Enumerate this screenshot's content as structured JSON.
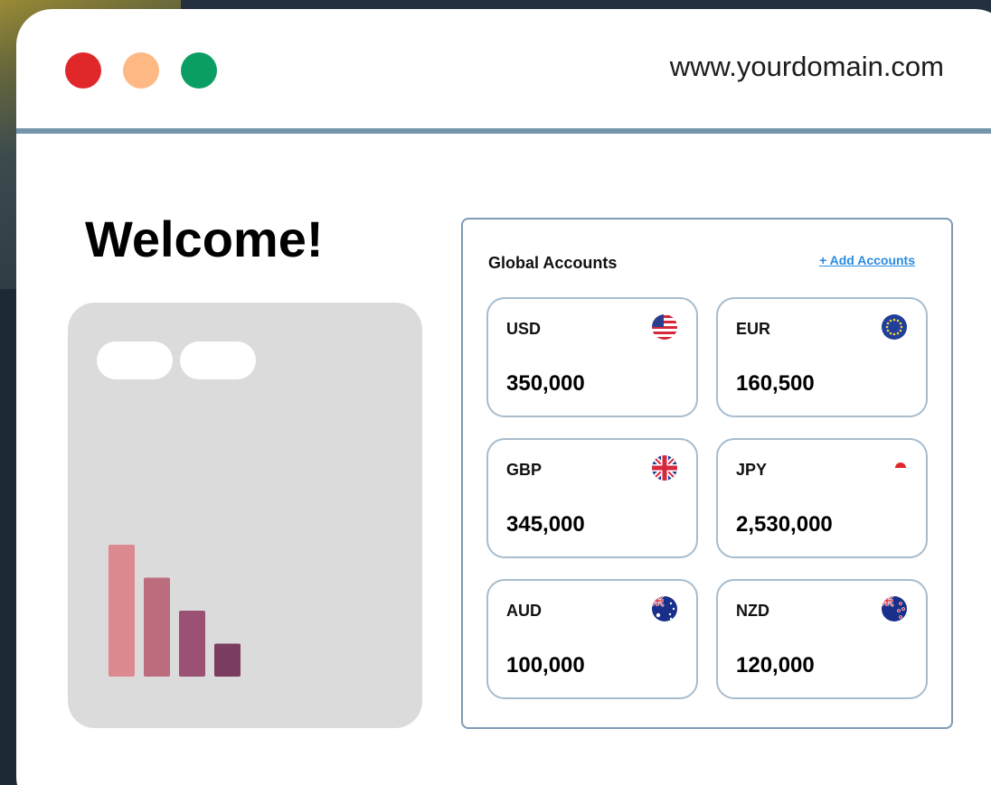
{
  "browser": {
    "url": "www.yourdomain.com"
  },
  "page": {
    "welcome": "Welcome!"
  },
  "chart_data": {
    "type": "bar",
    "values": [
      4,
      3,
      2,
      1
    ],
    "colors": [
      "#dc8a90",
      "#bb6d7e",
      "#9a5173",
      "#7a3d61"
    ]
  },
  "accounts": {
    "title": "Global Accounts",
    "add_label": "+ Add Accounts",
    "items": [
      {
        "code": "USD",
        "amount": "350,000",
        "flag": "us-flag-icon"
      },
      {
        "code": "EUR",
        "amount": "160,500",
        "flag": "eu-flag-icon"
      },
      {
        "code": "GBP",
        "amount": "345,000",
        "flag": "uk-flag-icon"
      },
      {
        "code": "JPY",
        "amount": "2,530,000",
        "flag": "jp-flag-icon"
      },
      {
        "code": "AUD",
        "amount": "100,000",
        "flag": "au-flag-icon"
      },
      {
        "code": "NZD",
        "amount": "120,000",
        "flag": "nz-flag-icon"
      }
    ]
  },
  "colors": {
    "window_bg": "#ffffff",
    "divider": "#7595ad",
    "dot_red": "#e0282b",
    "dot_orange": "#fdb884",
    "dot_green": "#0a9e63",
    "link": "#2a8be0",
    "card_border": "#a7bccd"
  }
}
